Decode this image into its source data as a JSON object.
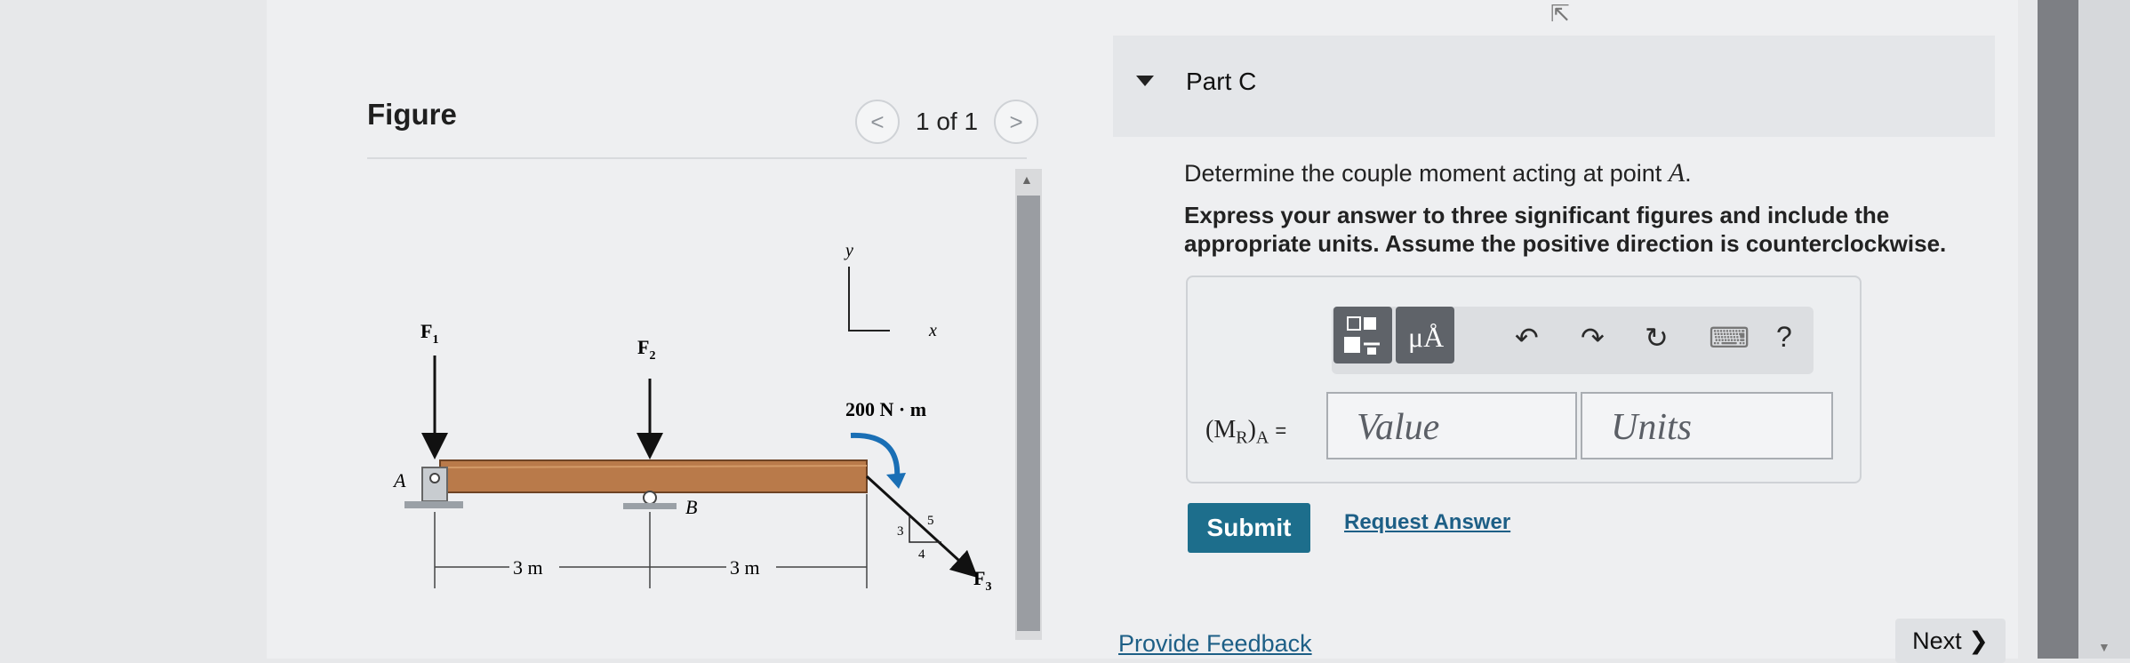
{
  "figure": {
    "title": "Figure",
    "pager_text": "1 of 1",
    "prev_glyph": "<",
    "next_glyph": ">",
    "labels": {
      "f1": "F",
      "f1_sub": "1",
      "f2": "F",
      "f2_sub": "2",
      "f3": "F",
      "f3_sub": "3",
      "a": "A",
      "b": "B",
      "y": "y",
      "x": "x",
      "couple": "200 N · m",
      "dim1": "3 m",
      "dim2": "3 m",
      "slope_5": "5",
      "slope_3": "3",
      "slope_4": "4"
    },
    "colors": {
      "beam": "#b97a4a",
      "support": "#9aa0a6"
    }
  },
  "part": {
    "title": "Part C",
    "question_prefix": "Determine the couple moment acting at point ",
    "question_var": "A",
    "question_suffix": ".",
    "instructions": "Express your answer to three significant figures and include the appropriate units. Assume the positive direction is counterclockwise.",
    "toolbar": {
      "templates_icon": "templates-icon",
      "units_label": "μÅ",
      "undo_glyph": "↶",
      "redo_glyph": "↷",
      "reset_glyph": "↻",
      "keyboard_glyph": "⌨",
      "help_glyph": "?"
    },
    "variable_label": "(M",
    "variable_sub": "R",
    "variable_label_end": ")",
    "variable_sub2": "A",
    "equals": "=",
    "value_placeholder": "Value",
    "units_placeholder": "Units",
    "submit_label": "Submit",
    "request_label": "Request Answer"
  },
  "footer": {
    "feedback_label": "Provide Feedback",
    "next_label": "Next",
    "next_glyph": "❯"
  },
  "accent_color": "#1d6e8c",
  "link_color": "#1d5f86"
}
